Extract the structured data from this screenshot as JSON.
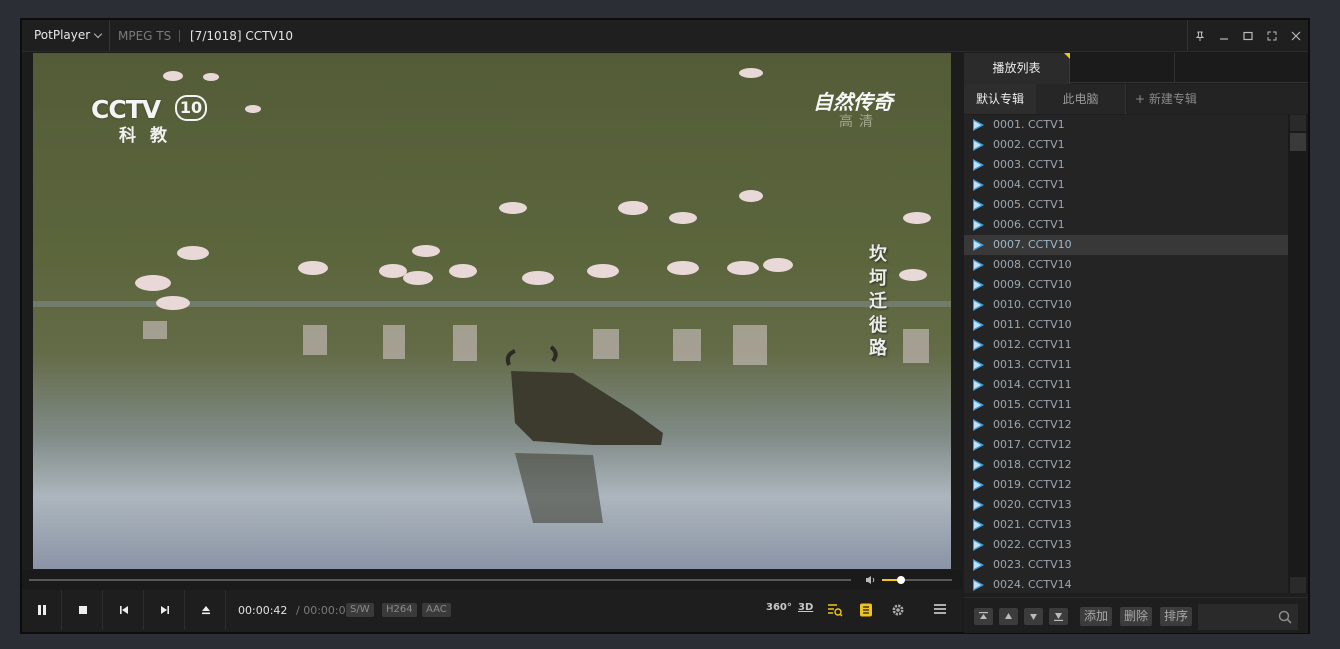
{
  "titlebar": {
    "app_name": "PotPlayer",
    "format": "MPEG TS",
    "title": "[7/1018] CCTV10"
  },
  "video": {
    "channel_logo": "CCTV",
    "channel_number": "10",
    "channel_sub": "科教",
    "show_logo": "自然传奇",
    "show_logo_sub": "高清",
    "subtitle": "坎坷迁徙路"
  },
  "controls": {
    "time_current": "00:00:42",
    "time_separator": "/",
    "time_total": "00:00:00",
    "tags": [
      "S/W",
      "H264",
      "AAC"
    ],
    "label_360": "360°",
    "label_3d": "3D",
    "volume_level": 0.27,
    "seek_progress": 0.0
  },
  "panel": {
    "main_tab": "播放列表",
    "sub_tabs": [
      "默认专辑",
      "此电脑",
      "+ 新建专辑"
    ],
    "selected_index": 6,
    "items": [
      "0001. CCTV1",
      "0002. CCTV1",
      "0003. CCTV1",
      "0004. CCTV1",
      "0005. CCTV1",
      "0006. CCTV1",
      "0007. CCTV10",
      "0008. CCTV10",
      "0009. CCTV10",
      "0010. CCTV10",
      "0011. CCTV10",
      "0012. CCTV11",
      "0013. CCTV11",
      "0014. CCTV11",
      "0015. CCTV11",
      "0016. CCTV12",
      "0017. CCTV12",
      "0018. CCTV12",
      "0019. CCTV12",
      "0020. CCTV13",
      "0021. CCTV13",
      "0022. CCTV13",
      "0023. CCTV13",
      "0024. CCTV14"
    ],
    "footer": {
      "add": "添加",
      "delete": "删除",
      "sort": "排序"
    }
  },
  "colors": {
    "accent": "#f0c419",
    "play_icon": "#3d9fe0"
  }
}
